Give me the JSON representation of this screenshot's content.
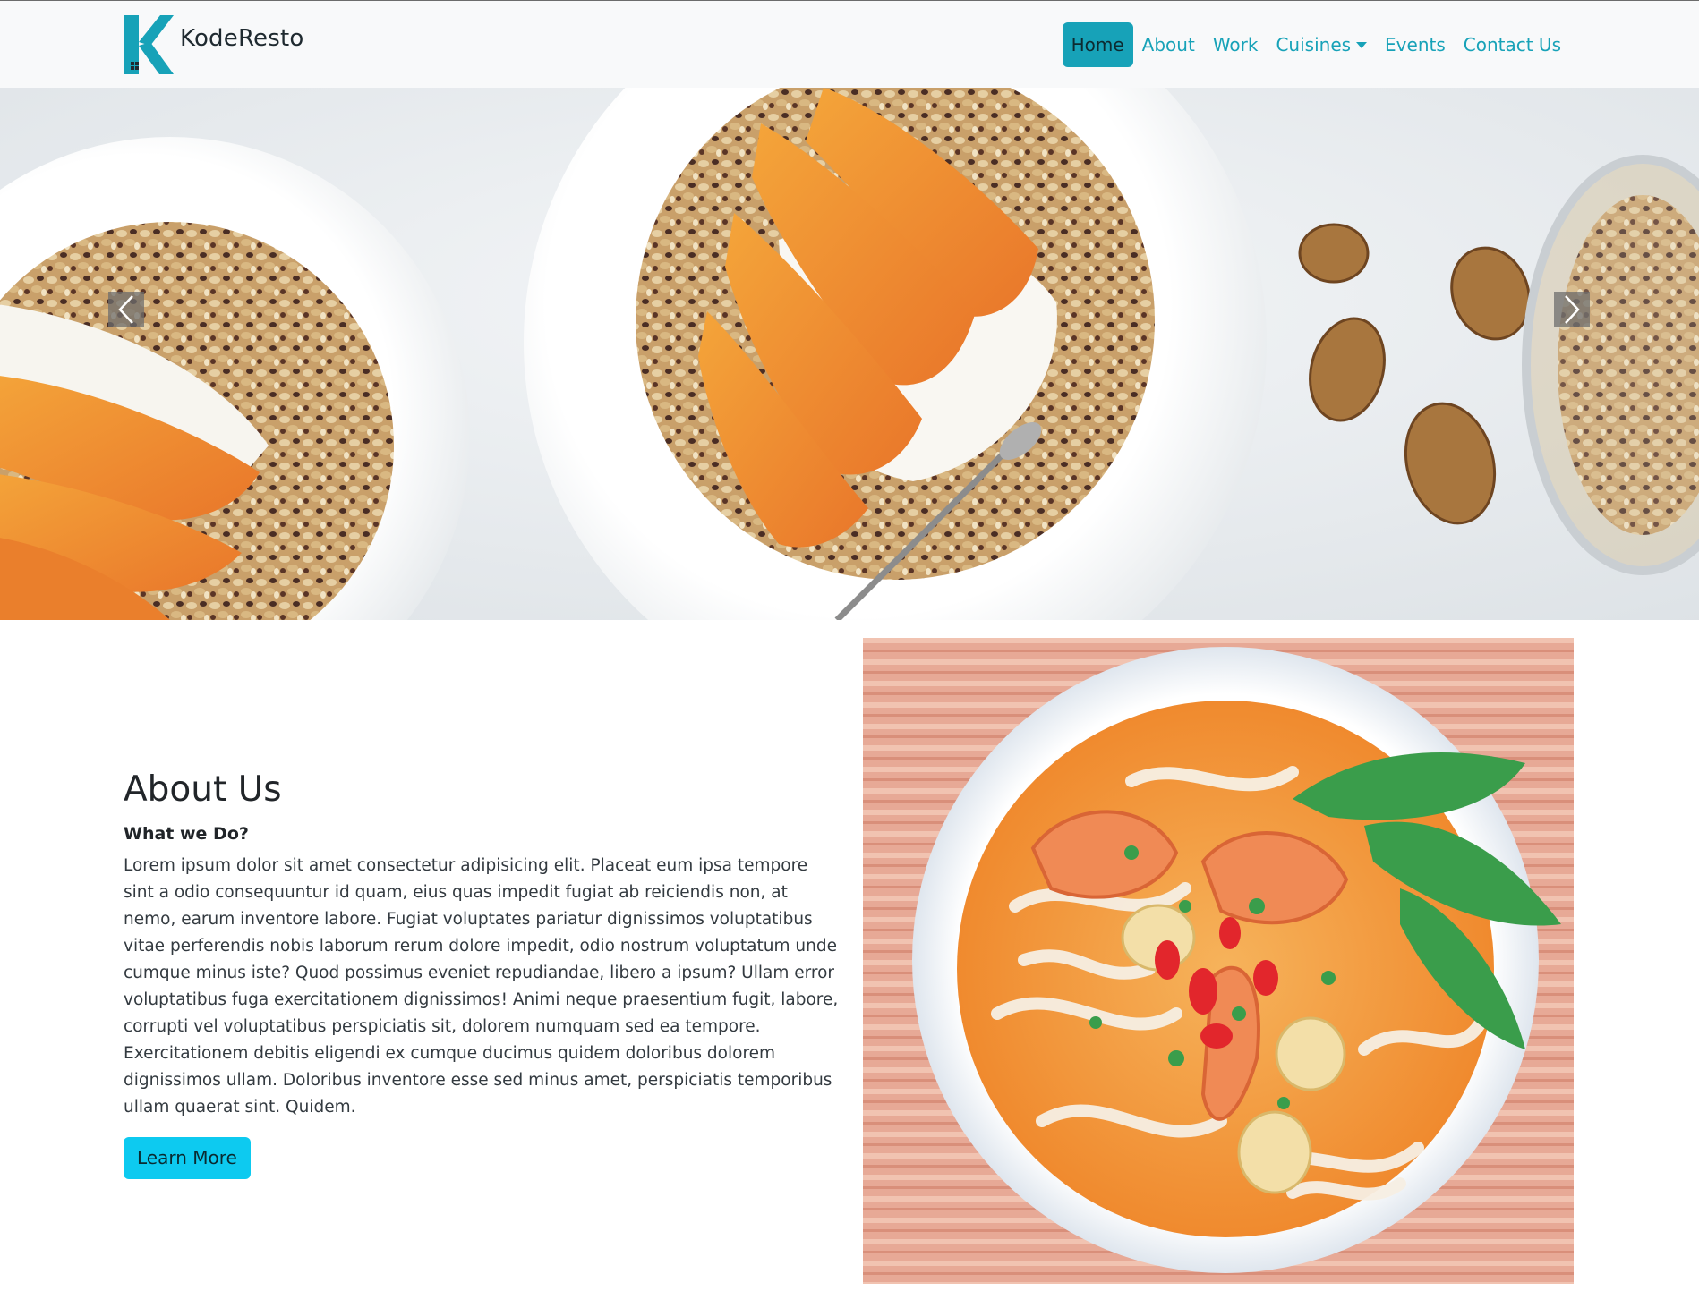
{
  "brand": {
    "name": "KodeResto",
    "logo_icon": "k-logo-icon"
  },
  "nav": {
    "items": [
      {
        "label": "Home",
        "active": true
      },
      {
        "label": "About"
      },
      {
        "label": "Work"
      },
      {
        "label": "Cuisines",
        "dropdown": true
      },
      {
        "label": "Events"
      },
      {
        "label": "Contact Us"
      }
    ]
  },
  "carousel": {
    "prev_icon": "chevron-left-icon",
    "next_icon": "chevron-right-icon"
  },
  "about": {
    "title": "About Us",
    "subtitle": "What we Do?",
    "body": "Lorem ipsum dolor sit amet consectetur adipisicing elit. Placeat eum ipsa tempore sint a odio consequuntur id quam, eius quas impedit fugiat ab reiciendis non, at nemo, earum inventore labore. Fugiat voluptates pariatur dignissimos voluptatibus vitae perferendis nobis laborum rerum dolore impedit, odio nostrum voluptatum unde cumque minus iste? Quod possimus eveniet repudiandae, libero a ipsum? Ullam error voluptatibus fuga exercitationem dignissimos! Animi neque praesentium fugit, labore, corrupti vel voluptatibus perspiciatis sit, dolorem numquam sed ea tempore. Exercitationem debitis eligendi ex cumque ducimus quidem doloribus dolorem dignissimos ullam. Doloribus inventore esse sed minus amet, perspiciatis temporibus ullam quaerat sint. Quidem.",
    "button_label": "Learn More"
  },
  "colors": {
    "accent": "#17a2b8",
    "button": "#0dcaf0",
    "navbar_bg": "#f8f9fa"
  }
}
